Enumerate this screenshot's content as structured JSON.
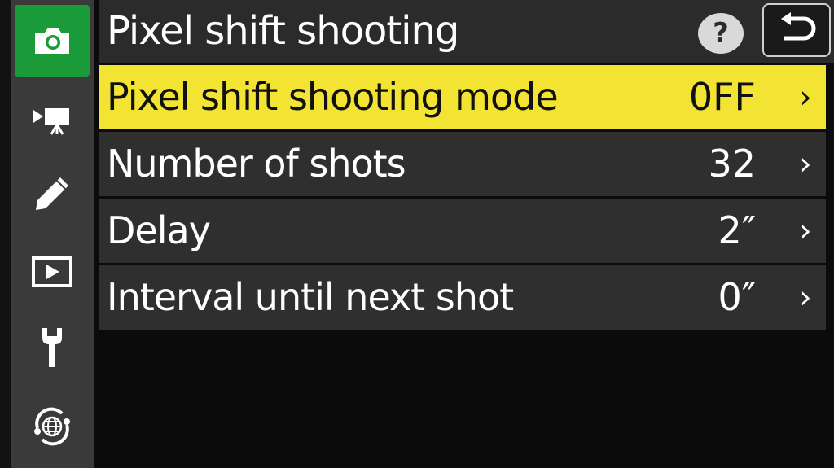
{
  "header": {
    "title": "Pixel shift shooting",
    "help_glyph": "?"
  },
  "sidebar": {
    "items": [
      {
        "icon": "camera-icon",
        "active": true
      },
      {
        "icon": "movie-camera-icon",
        "active": false
      },
      {
        "icon": "pencil-icon",
        "active": false
      },
      {
        "icon": "playback-icon",
        "active": false
      },
      {
        "icon": "wrench-icon",
        "active": false
      },
      {
        "icon": "network-globe-icon",
        "active": false
      }
    ]
  },
  "menu": {
    "items": [
      {
        "label": "Pixel shift shooting mode",
        "value": "0FF",
        "selected": true
      },
      {
        "label": "Number of shots",
        "value": "32",
        "selected": false
      },
      {
        "label": "Delay",
        "value": "2″",
        "selected": false
      },
      {
        "label": "Interval until next shot",
        "value": "0″",
        "selected": false
      }
    ],
    "chevron": "›"
  },
  "colors": {
    "selected_row": "#f3e332",
    "row": "#2f2f2f",
    "active_tab": "#1b9a3a",
    "sidebar": "#3a3a3a"
  }
}
